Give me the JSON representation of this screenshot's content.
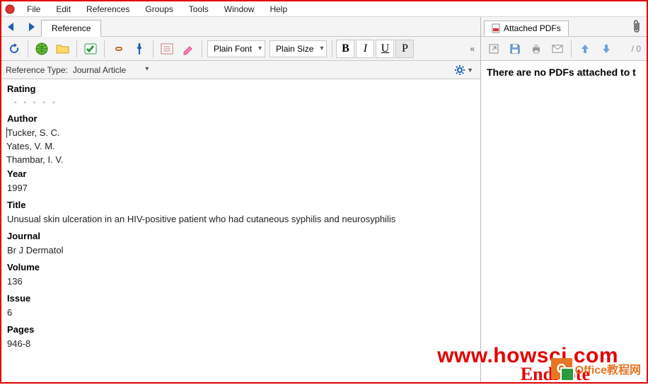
{
  "menu": {
    "file": "File",
    "edit": "Edit",
    "references": "References",
    "groups": "Groups",
    "tools": "Tools",
    "window": "Window",
    "help": "Help"
  },
  "tab_left": "Reference",
  "font_name": "Plain Font",
  "font_size": "Plain Size",
  "fmt": {
    "b": "B",
    "i": "I",
    "u": "U",
    "p": "P"
  },
  "ref_type_label": "Reference Type:",
  "ref_type_value": "Journal Article",
  "fields": {
    "rating_label": "Rating",
    "author_label": "Author",
    "authors": [
      "Tucker, S. C.",
      "Yates, V. M.",
      "Thambar, I. V."
    ],
    "year_label": "Year",
    "year": "1997",
    "title_label": "Title",
    "title": "Unusual skin ulceration in an HIV-positive patient who had cutaneous syphilis and neurosyphilis",
    "journal_label": "Journal",
    "journal": "Br J Dermatol",
    "volume_label": "Volume",
    "volume": "136",
    "issue_label": "Issue",
    "issue": "6",
    "pages_label": "Pages",
    "pages": "946-8"
  },
  "right": {
    "tab": "Attached PDFs",
    "pagecount": "/ 0",
    "nopdf": "There are no PDFs attached to t"
  },
  "watermark": {
    "url": "www.howsci.com",
    "brand": "EndNote",
    "office": "Office教程网"
  }
}
